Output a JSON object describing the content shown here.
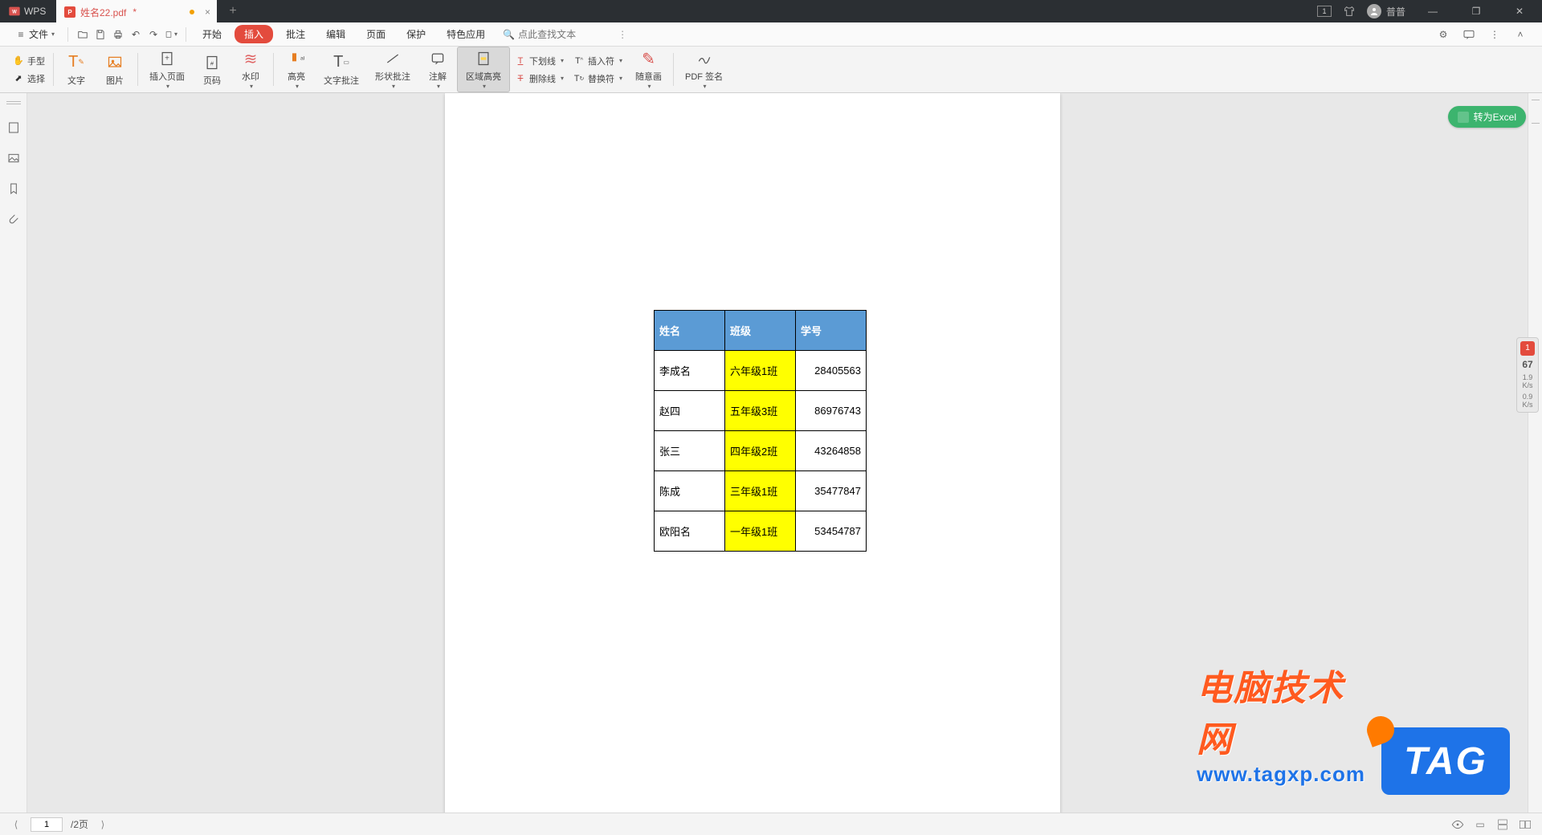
{
  "title_bar": {
    "app_name": "WPS",
    "tab_file": "姓名22.pdf",
    "tab_modified": "*",
    "user_name": "普普",
    "tray_badge": "1"
  },
  "menu": {
    "file": "文件",
    "tabs": {
      "start": "开始",
      "insert": "插入",
      "annotate": "批注",
      "edit": "编辑",
      "page": "页面",
      "protect": "保护",
      "special": "特色应用"
    },
    "search_placeholder": "点此查找文本",
    "search_more": "⋮"
  },
  "ribbon": {
    "hand": "手型",
    "select": "选择",
    "text": "文字",
    "image": "图片",
    "insert_page": "插入页面",
    "page_number": "页码",
    "watermark": "水印",
    "highlight": "高亮",
    "text_annot": "文字批注",
    "shape_annot": "形状批注",
    "note": "注解",
    "area_highlight": "区域高亮",
    "underline": "下划线",
    "strikeout": "删除线",
    "insert_char": "插入符",
    "replace_char": "替换符",
    "freehand": "随意画",
    "pdf_sign": "PDF 签名"
  },
  "float": {
    "to_excel": "转为Excel",
    "meter_badge": "1",
    "meter_pct": "67",
    "meter_up_v": "1.9",
    "meter_up_u": "K/s",
    "meter_dn_v": "0.9",
    "meter_dn_u": "K/s"
  },
  "table": {
    "headers": {
      "name": "姓名",
      "class": "班级",
      "id": "学号"
    },
    "rows": [
      {
        "name": "李成名",
        "class": "六年级1班",
        "id": "28405563"
      },
      {
        "name": "赵四",
        "class": "五年级3班",
        "id": "86976743"
      },
      {
        "name": "张三",
        "class": "四年级2班",
        "id": "43264858"
      },
      {
        "name": "陈成",
        "class": "三年级1班",
        "id": "35477847"
      },
      {
        "name": "欧阳名",
        "class": "一年级1班",
        "id": "53454787"
      }
    ]
  },
  "status": {
    "page_current": "1",
    "page_total": "/2页"
  },
  "watermark": {
    "line1": "电脑技术网",
    "url": "www.tagxp.com",
    "tag": "TAG"
  }
}
